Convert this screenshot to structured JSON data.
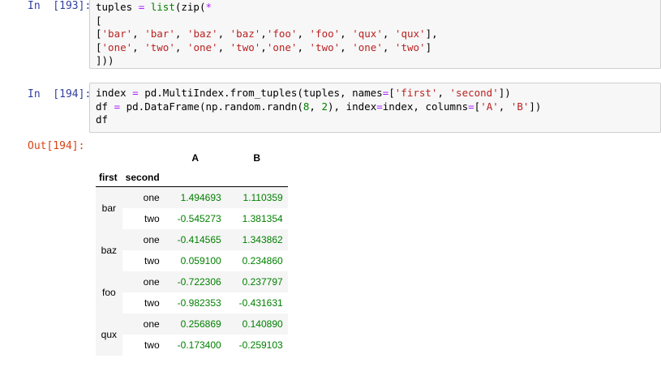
{
  "cells": [
    {
      "prompt": "In  [193]:",
      "code_lines": [
        [
          {
            "t": "tuples "
          },
          {
            "t": "=",
            "c": "op"
          },
          {
            "t": " "
          },
          {
            "t": "list",
            "c": "fn"
          },
          {
            "t": "(zip("
          },
          {
            "t": "*",
            "c": "op"
          }
        ],
        [
          {
            "t": "["
          }
        ],
        [
          {
            "t": "["
          },
          {
            "t": "'bar'",
            "c": "str"
          },
          {
            "t": ", "
          },
          {
            "t": "'bar'",
            "c": "str"
          },
          {
            "t": ", "
          },
          {
            "t": "'baz'",
            "c": "str"
          },
          {
            "t": ", "
          },
          {
            "t": "'baz'",
            "c": "str"
          },
          {
            "t": ","
          },
          {
            "t": "'foo'",
            "c": "str"
          },
          {
            "t": ", "
          },
          {
            "t": "'foo'",
            "c": "str"
          },
          {
            "t": ", "
          },
          {
            "t": "'qux'",
            "c": "str"
          },
          {
            "t": ", "
          },
          {
            "t": "'qux'",
            "c": "str"
          },
          {
            "t": "],"
          }
        ],
        [
          {
            "t": "["
          },
          {
            "t": "'one'",
            "c": "str"
          },
          {
            "t": ", "
          },
          {
            "t": "'two'",
            "c": "str"
          },
          {
            "t": ", "
          },
          {
            "t": "'one'",
            "c": "str"
          },
          {
            "t": ", "
          },
          {
            "t": "'two'",
            "c": "str"
          },
          {
            "t": ","
          },
          {
            "t": "'one'",
            "c": "str"
          },
          {
            "t": ", "
          },
          {
            "t": "'two'",
            "c": "str"
          },
          {
            "t": ", "
          },
          {
            "t": "'one'",
            "c": "str"
          },
          {
            "t": ", "
          },
          {
            "t": "'two'",
            "c": "str"
          },
          {
            "t": "]"
          }
        ],
        [
          {
            "t": "]))"
          }
        ]
      ]
    },
    {
      "prompt": "In  [194]:",
      "code_lines": [
        [
          {
            "t": "index "
          },
          {
            "t": "=",
            "c": "op"
          },
          {
            "t": " pd.MultiIndex.from_tuples(tuples, names"
          },
          {
            "t": "=",
            "c": "op"
          },
          {
            "t": "["
          },
          {
            "t": "'first'",
            "c": "str"
          },
          {
            "t": ", "
          },
          {
            "t": "'second'",
            "c": "str"
          },
          {
            "t": "])"
          }
        ],
        [
          {
            "t": "df "
          },
          {
            "t": "=",
            "c": "op"
          },
          {
            "t": " pd.DataFrame(np.random.randn("
          },
          {
            "t": "8",
            "c": "num"
          },
          {
            "t": ", "
          },
          {
            "t": "2",
            "c": "num"
          },
          {
            "t": "), index"
          },
          {
            "t": "=",
            "c": "op"
          },
          {
            "t": "index, columns"
          },
          {
            "t": "=",
            "c": "op"
          },
          {
            "t": "["
          },
          {
            "t": "'A'",
            "c": "str"
          },
          {
            "t": ", "
          },
          {
            "t": "'B'",
            "c": "str"
          },
          {
            "t": "])"
          }
        ],
        [
          {
            "t": "df"
          }
        ]
      ]
    }
  ],
  "output": {
    "prompt": "Out[194]:",
    "columns": [
      "A",
      "B"
    ],
    "index_names": [
      "first",
      "second"
    ],
    "groups": [
      {
        "first": "bar",
        "rows": [
          {
            "second": "one",
            "A": "1.494693",
            "B": "1.110359"
          },
          {
            "second": "two",
            "A": "-0.545273",
            "B": "1.381354"
          }
        ]
      },
      {
        "first": "baz",
        "rows": [
          {
            "second": "one",
            "A": "-0.414565",
            "B": "1.343862"
          },
          {
            "second": "two",
            "A": "0.059100",
            "B": "0.234860"
          }
        ]
      },
      {
        "first": "foo",
        "rows": [
          {
            "second": "one",
            "A": "-0.722306",
            "B": "0.237797"
          },
          {
            "second": "two",
            "A": "-0.982353",
            "B": "-0.431631"
          }
        ]
      },
      {
        "first": "qux",
        "rows": [
          {
            "second": "one",
            "A": "0.256869",
            "B": "0.140890"
          },
          {
            "second": "two",
            "A": "-0.173400",
            "B": "-0.259103"
          }
        ]
      }
    ]
  },
  "colors": {
    "prompt_in": "#303f9f",
    "prompt_out": "#d84315",
    "keyword": "#aa22ff",
    "builtin": "#008000",
    "string": "#ba2121",
    "code_bg": "#f7f7f7"
  }
}
